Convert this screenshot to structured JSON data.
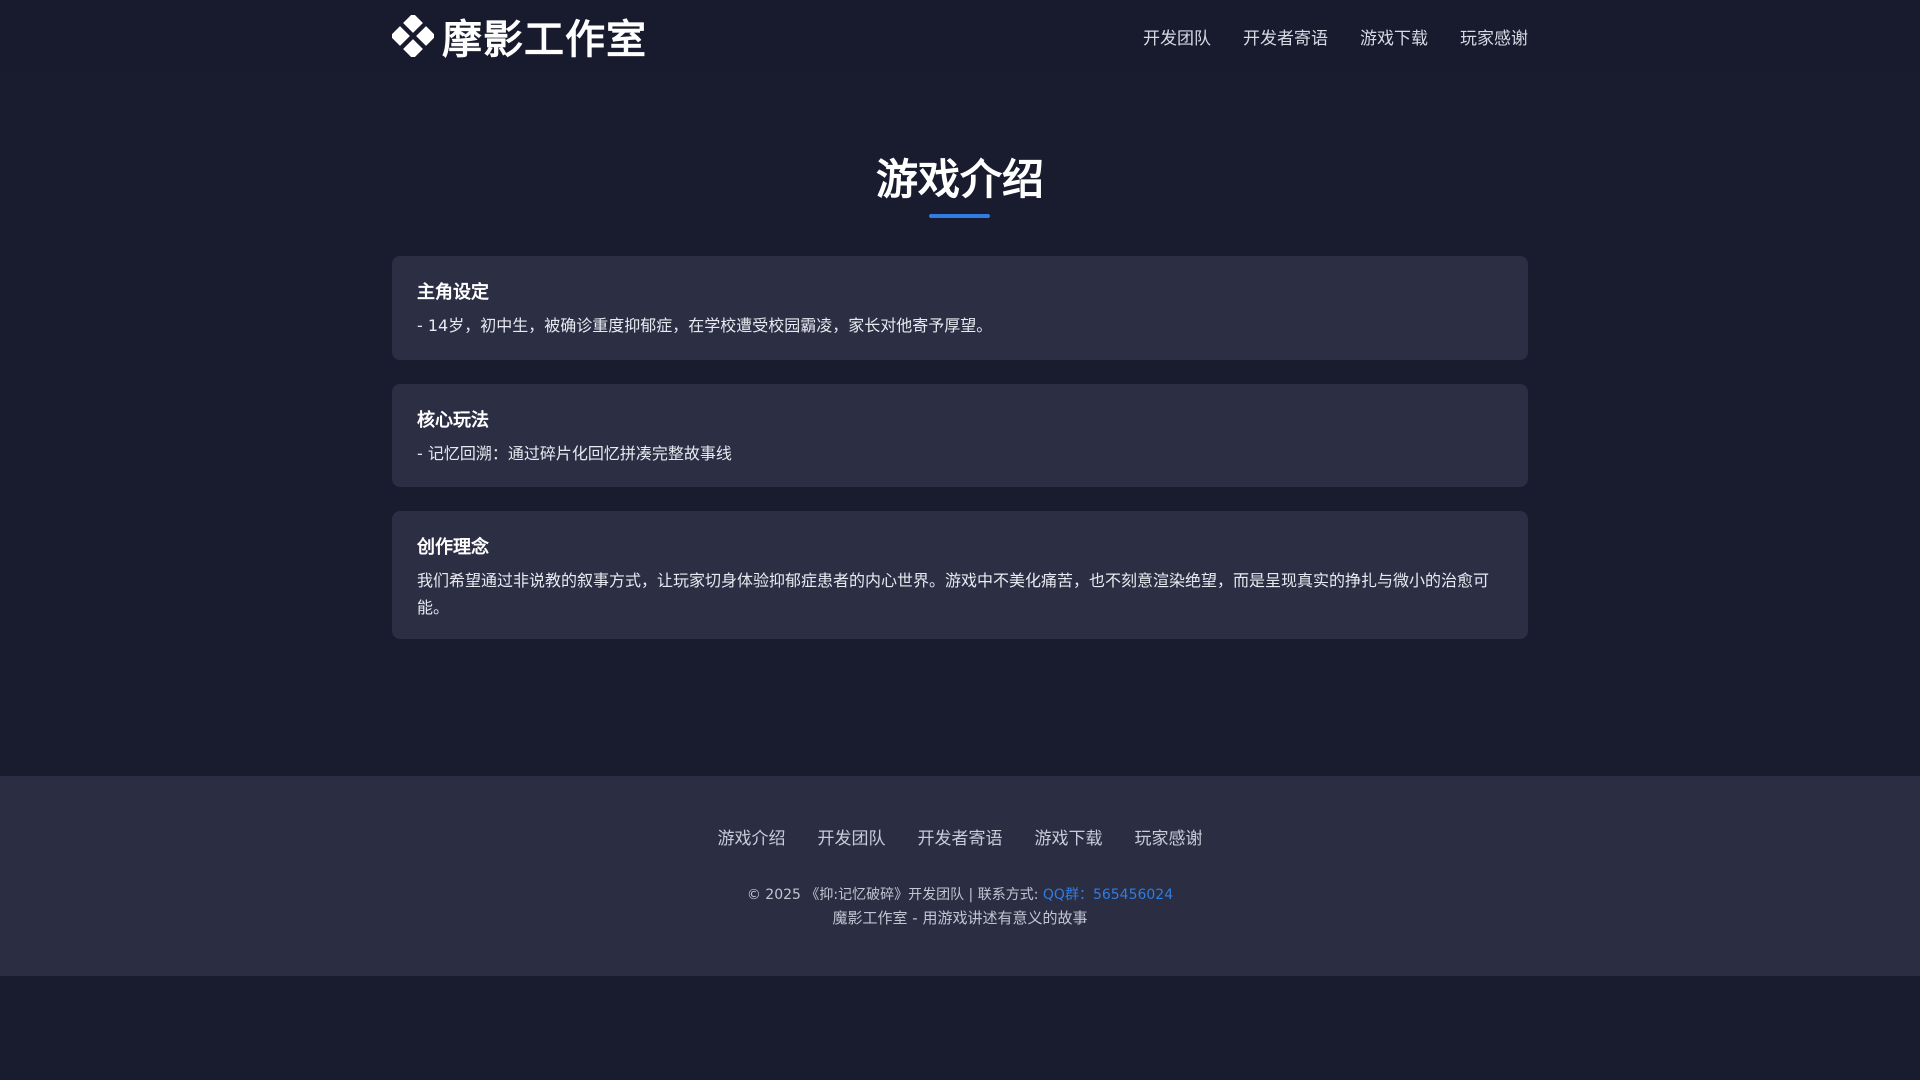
{
  "header": {
    "logo_text": "摩影工作室",
    "nav": [
      "开发团队",
      "开发者寄语",
      "游戏下载",
      "玩家感谢"
    ]
  },
  "main": {
    "title": "游戏介绍",
    "cards": [
      {
        "heading": "主角设定",
        "body": "- 14岁，初中生，被确诊重度抑郁症，在学校遭受校园霸凌，家长对他寄予厚望。"
      },
      {
        "heading": "核心玩法",
        "body": "- 记忆回溯：通过碎片化回忆拼凑完整故事线"
      },
      {
        "heading": "创作理念",
        "body": "我们希望通过非说教的叙事方式，让玩家切身体验抑郁症患者的内心世界。游戏中不美化痛苦，也不刻意渲染绝望，而是呈现真实的挣扎与微小的治愈可能。"
      }
    ]
  },
  "footer": {
    "nav": [
      "游戏介绍",
      "开发团队",
      "开发者寄语",
      "游戏下载",
      "玩家感谢"
    ],
    "copyright": "© 2025 《抑:记忆破碎》开发团队 | 联系方式:",
    "qq": "QQ群：565456024",
    "slogan": "魔影工作室 - 用游戏讲述有意义的故事"
  },
  "colors": {
    "background": "#191b2f",
    "card": "#2c2e44",
    "accent": "#2f7de0"
  }
}
